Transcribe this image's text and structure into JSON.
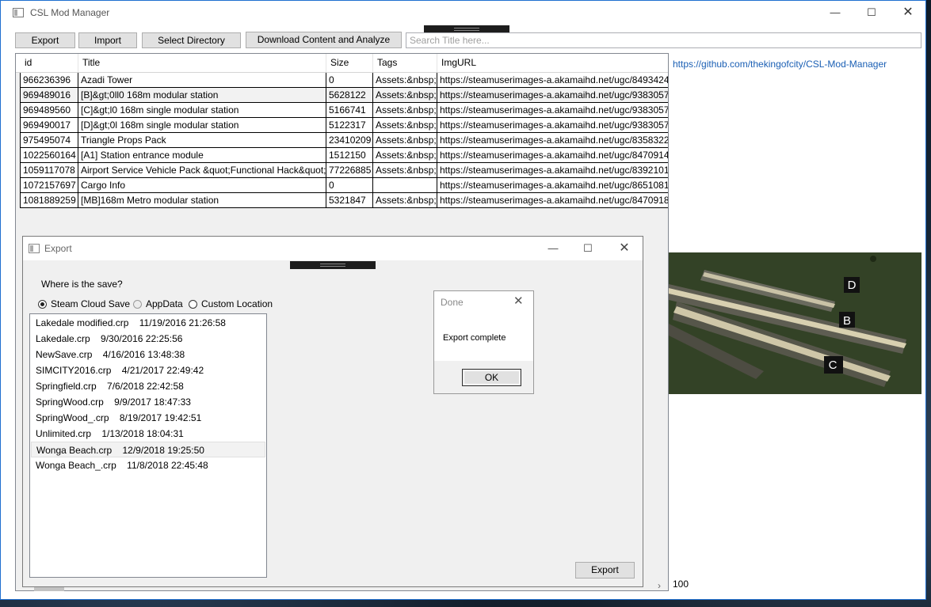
{
  "window": {
    "title": "CSL Mod Manager",
    "min_glyph": "—",
    "max_glyph": "☐",
    "close_glyph": "✕"
  },
  "toolbar": {
    "export_label": "Export",
    "import_label": "Import",
    "select_directory_label": "Select Directory",
    "download_label": "Download Content and Analyze",
    "search_placeholder": "Search Title here..."
  },
  "grid": {
    "columns": [
      "id",
      "Title",
      "Size",
      "Tags",
      "ImgURL"
    ],
    "rows": [
      {
        "id": "966236396",
        "title": "Azadi Tower",
        "size": "0",
        "tags": "Assets:&nbsp;",
        "img": "https://steamuserimages-a.akamaihd.net/ugc/8493424"
      },
      {
        "id": "969489016",
        "title": "[B]&gt;0ll0 168m modular station",
        "size": "5628122",
        "tags": "Assets:&nbsp;",
        "img": "https://steamuserimages-a.akamaihd.net/ugc/9383057"
      },
      {
        "id": "969489560",
        "title": "[C]&gt;l0 168m single modular station",
        "size": "5166741",
        "tags": "Assets:&nbsp;",
        "img": "https://steamuserimages-a.akamaihd.net/ugc/9383057"
      },
      {
        "id": "969490017",
        "title": "[D]&gt;0l 168m single modular station",
        "size": "5122317",
        "tags": "Assets:&nbsp;",
        "img": "https://steamuserimages-a.akamaihd.net/ugc/9383057"
      },
      {
        "id": "975495074",
        "title": "Triangle Props Pack",
        "size": "23410209",
        "tags": "Assets:&nbsp;",
        "img": "https://steamuserimages-a.akamaihd.net/ugc/8358322"
      },
      {
        "id": "1022560164",
        "title": "[A1] Station entrance module",
        "size": "1512150",
        "tags": "Assets:&nbsp;",
        "img": "https://steamuserimages-a.akamaihd.net/ugc/8470914"
      },
      {
        "id": "1059117078",
        "title": "Airport Service Vehicle Pack &quot;Functional Hack&quot;",
        "size": "77226885",
        "tags": "Assets:&nbsp;",
        "img": "https://steamuserimages-a.akamaihd.net/ugc/8392101"
      },
      {
        "id": "1072157697",
        "title": "Cargo Info",
        "size": "0",
        "tags": "",
        "img": "https://steamuserimages-a.akamaihd.net/ugc/8651081"
      },
      {
        "id": "1081889259",
        "title": "[MB]168m Metro modular station",
        "size": "5321847",
        "tags": "Assets:&nbsp;",
        "img": "https://steamuserimages-a.akamaihd.net/ugc/8470918"
      }
    ],
    "selected_row_index": 1
  },
  "sidepanel": {
    "github_link": "https://github.com/thekingofcity/CSL-Mod-Manager",
    "count": "100",
    "preview_labels": [
      "D",
      "B",
      "C"
    ]
  },
  "export_dialog": {
    "title": "Export",
    "question": "Where is the save?",
    "options": [
      "Steam Cloud Save",
      "AppData",
      "Custom Location"
    ],
    "selected_option": "Steam Cloud Save",
    "saves": [
      "Lakedale modified.crp    11/19/2016 21:26:58",
      "Lakedale.crp    9/30/2016 22:25:56",
      "NewSave.crp    4/16/2016 13:48:38",
      "SIMCITY2016.crp    4/21/2017 22:49:42",
      "Springfield.crp    7/6/2018 22:42:58",
      "SpringWood.crp    9/9/2017 18:47:33",
      "SpringWood_.crp    8/19/2017 19:42:51",
      "Unlimited.crp    1/13/2018 18:04:31",
      "Wonga Beach.crp    12/9/2018 19:25:50",
      "Wonga Beach_.crp    11/8/2018 22:45:48"
    ],
    "selected_save_index": 8,
    "export_button": "Export"
  },
  "done_box": {
    "title": "Done",
    "message": "Export complete",
    "ok_label": "OK"
  },
  "colors": {
    "window_border": "#1f6fd0",
    "link": "#1a5fb4",
    "button_face": "#e1e1e1"
  }
}
